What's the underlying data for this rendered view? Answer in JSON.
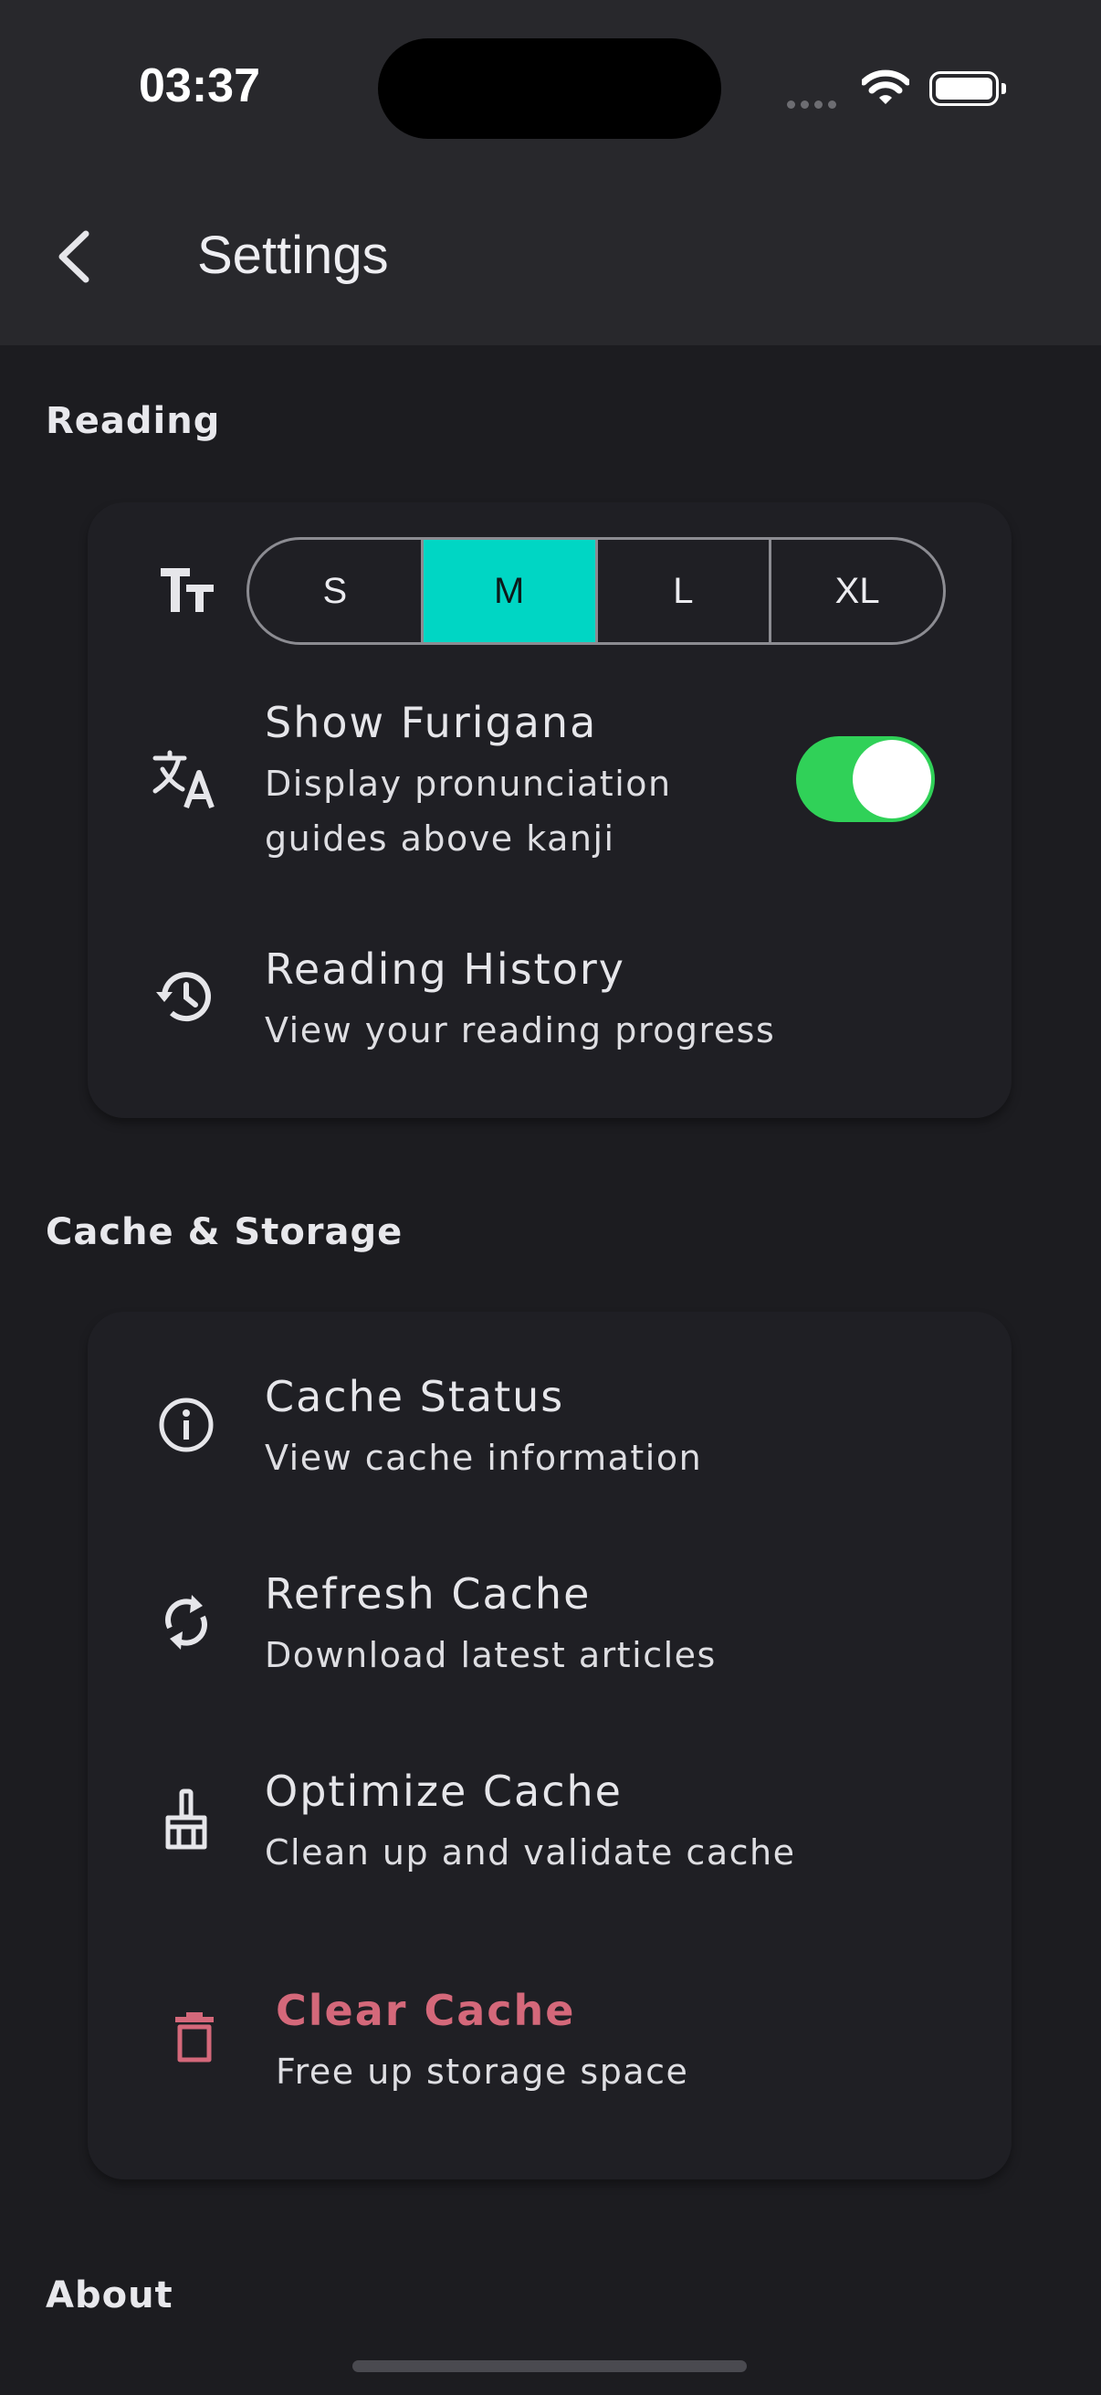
{
  "status_bar": {
    "time": "03:37"
  },
  "app_bar": {
    "title": "Settings"
  },
  "reading": {
    "section_title": "Reading",
    "font_sizes": [
      "S",
      "M",
      "L",
      "XL"
    ],
    "selected_font_size": "M",
    "furigana": {
      "title": "Show Furigana",
      "subtitle_line1": "Display pronunciation",
      "subtitle_line2": "guides above kanji",
      "enabled": true
    },
    "history": {
      "title": "Reading History",
      "subtitle": "View your reading progress"
    }
  },
  "cache": {
    "section_title": "Cache & Storage",
    "status": {
      "title": "Cache Status",
      "subtitle": "View cache information"
    },
    "refresh": {
      "title": "Refresh Cache",
      "subtitle": "Download latest articles"
    },
    "optimize": {
      "title": "Optimize Cache",
      "subtitle": "Clean up and validate cache"
    },
    "clear": {
      "title": "Clear Cache",
      "subtitle": "Free up storage space"
    }
  },
  "about": {
    "section_title": "About"
  },
  "colors": {
    "accent": "#00d6c4",
    "toggle_on": "#30d158",
    "danger": "#d4687a",
    "background": "#1c1c20",
    "bar": "#28282c"
  }
}
